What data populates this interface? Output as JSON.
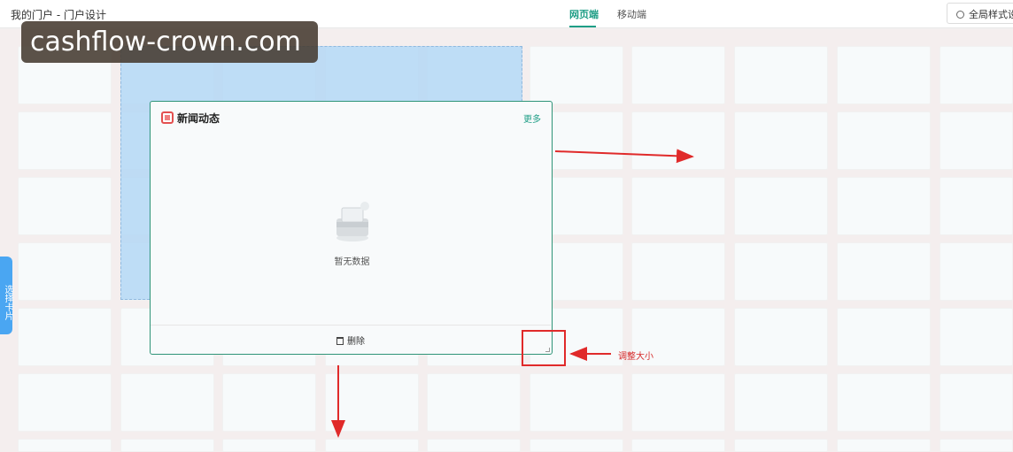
{
  "header": {
    "title": "我的门户 - 门户设计",
    "tabs": [
      {
        "label": "网页端",
        "active": true
      },
      {
        "label": "移动端",
        "active": false
      }
    ],
    "global_style_label": "全局样式设置"
  },
  "card": {
    "title": "新闻动态",
    "more_label": "更多",
    "empty_text": "暂无数据",
    "delete_label": "删除"
  },
  "annotation": {
    "resize_label": "调整大小"
  },
  "sidebar": {
    "select_card_label": "选择卡片"
  },
  "watermark": {
    "text": "cashflow-crown.com"
  },
  "colors": {
    "accent": "#1f9e86",
    "card_border": "#2f9478",
    "annotation_red": "#e02a2a",
    "side_tab": "#4aa6f2",
    "drag_ghost": "#b4d7f5"
  }
}
